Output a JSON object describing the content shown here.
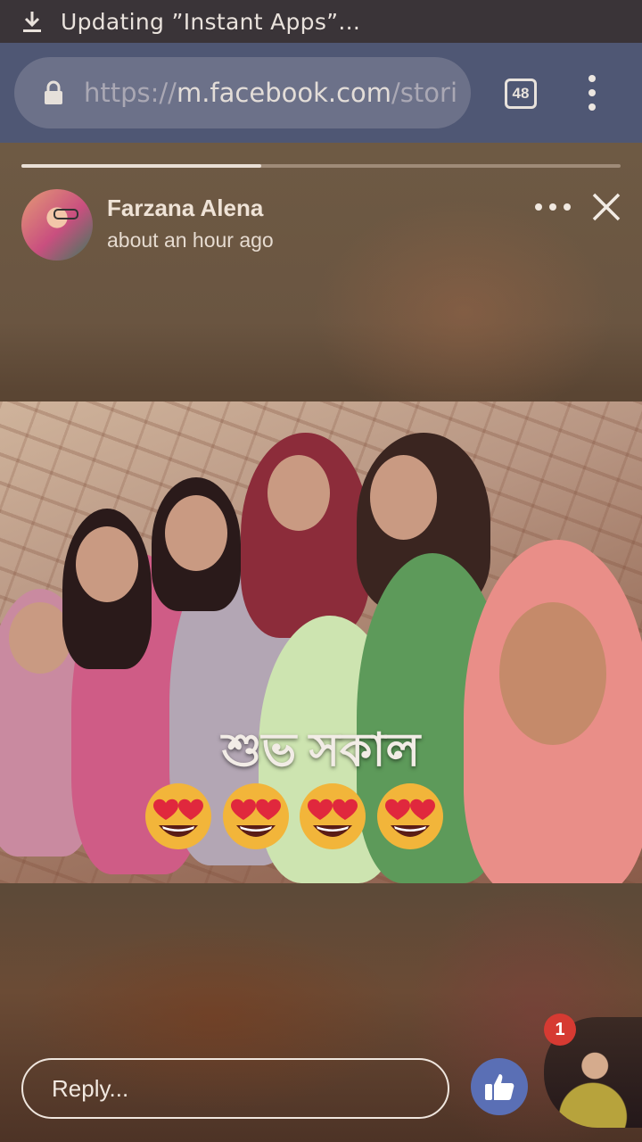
{
  "status_bar": {
    "text": "Updating ”Instant Apps”..."
  },
  "browser": {
    "url_scheme": "https://",
    "url_host": "m.facebook.com",
    "url_path": "/storie",
    "tab_count": "48"
  },
  "story": {
    "progress": 0.4,
    "poster_name": "Farzana Alena",
    "posted_time": "about an hour ago",
    "caption": "শুভ সকাল",
    "emoji_count": 4
  },
  "reply": {
    "placeholder": "Reply..."
  },
  "chat_head": {
    "badge_count": "1"
  },
  "colors": {
    "toolbar": "#4f5774",
    "like_button": "#5a6fb5",
    "badge": "#d63a32"
  }
}
